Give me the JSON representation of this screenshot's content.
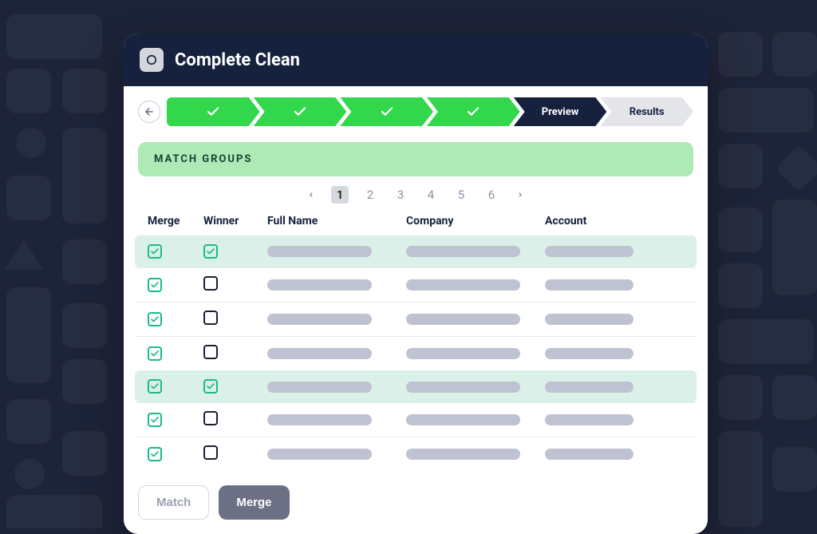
{
  "app": {
    "title": "Complete Clean"
  },
  "stepper": {
    "active_label": "Preview",
    "next_label": "Results"
  },
  "section_title": "MATCH GROUPS",
  "pagination": {
    "pages": [
      "1",
      "2",
      "3",
      "4",
      "5",
      "6"
    ],
    "active": "1"
  },
  "columns": {
    "merge": "Merge",
    "winner": "Winner",
    "full_name": "Full Name",
    "company": "Company",
    "account": "Account"
  },
  "rows": [
    {
      "merge_checked": true,
      "winner_checked": true,
      "highlight": true
    },
    {
      "merge_checked": true,
      "winner_checked": false,
      "highlight": false
    },
    {
      "merge_checked": true,
      "winner_checked": false,
      "highlight": false
    },
    {
      "merge_checked": true,
      "winner_checked": false,
      "highlight": false
    },
    {
      "merge_checked": true,
      "winner_checked": true,
      "highlight": true
    },
    {
      "merge_checked": true,
      "winner_checked": false,
      "highlight": false
    },
    {
      "merge_checked": true,
      "winner_checked": false,
      "highlight": false
    }
  ],
  "footer": {
    "match_label": "Match",
    "merge_label": "Merge"
  },
  "colors": {
    "accent_green": "#32d74b",
    "panel_dark": "#16213e",
    "pill_gray": "#bfc3d1"
  }
}
